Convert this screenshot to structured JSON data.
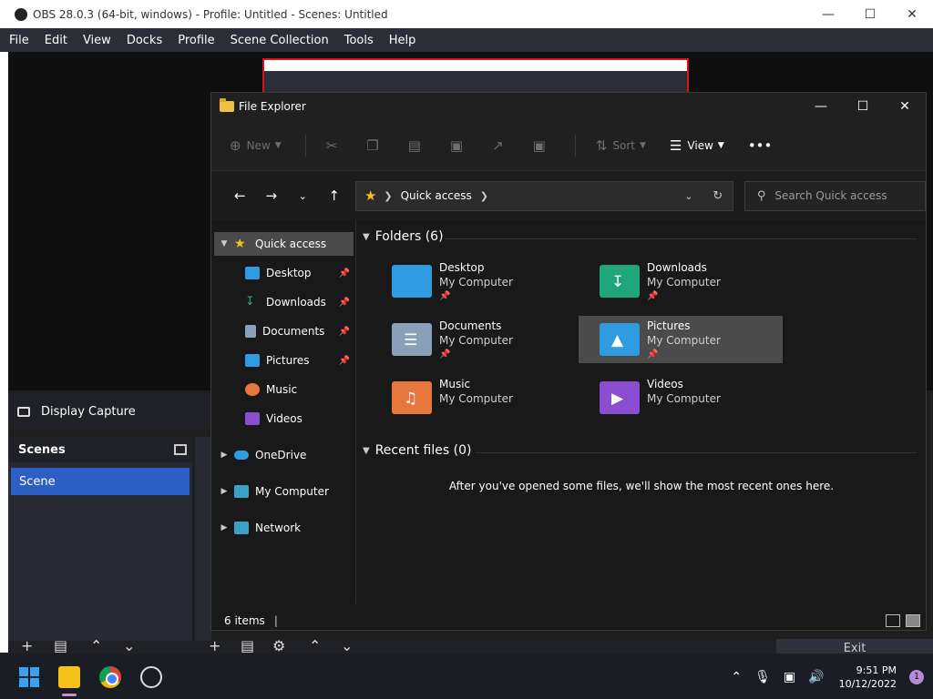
{
  "obs": {
    "title": "OBS 28.0.3 (64-bit, windows) - Profile: Untitled - Scenes: Untitled",
    "menu": [
      "File",
      "Edit",
      "View",
      "Docks",
      "Profile",
      "Scene Collection",
      "Tools",
      "Help"
    ],
    "source_label": "Display Capture",
    "scenes_header": "Scenes",
    "scene_item": "Scene",
    "exit_label": "Exit"
  },
  "explorer": {
    "title": "File Explorer",
    "cmd": {
      "new": "New",
      "sort": "Sort",
      "view": "View"
    },
    "address": {
      "root_crumb": "Quick access"
    },
    "search_placeholder": "Search Quick access",
    "tree": [
      {
        "label": "Quick access",
        "icon": "star-icon",
        "selected": true
      },
      {
        "label": "Desktop",
        "icon": "desktop-icon",
        "pinned": true
      },
      {
        "label": "Downloads",
        "icon": "download-icon",
        "pinned": true
      },
      {
        "label": "Documents",
        "icon": "document-icon",
        "pinned": true
      },
      {
        "label": "Pictures",
        "icon": "pictures-icon",
        "pinned": true
      },
      {
        "label": "Music",
        "icon": "music-icon"
      },
      {
        "label": "Videos",
        "icon": "videos-icon"
      },
      {
        "label": "OneDrive",
        "icon": "cloud-icon"
      },
      {
        "label": "My Computer",
        "icon": "computer-icon"
      },
      {
        "label": "Network",
        "icon": "network-icon"
      }
    ],
    "folders_header": "Folders (6)",
    "folders": [
      {
        "name": "Desktop",
        "location": "My Computer",
        "color": "#2f9be0",
        "pinned": true
      },
      {
        "name": "Downloads",
        "location": "My Computer",
        "color": "#1fa67a",
        "pinned": true
      },
      {
        "name": "Documents",
        "location": "My Computer",
        "color": "#8aa0b8",
        "pinned": true
      },
      {
        "name": "Pictures",
        "location": "My Computer",
        "color": "#2f9be0",
        "pinned": true
      },
      {
        "name": "Music",
        "location": "My Computer",
        "color": "#e8773e",
        "pinned": false
      },
      {
        "name": "Videos",
        "location": "My Computer",
        "color": "#8a4fd0",
        "pinned": false
      }
    ],
    "recent_header": "Recent files (0)",
    "recent_empty": "After you've opened some files, we'll show the most recent ones here.",
    "status_items": "6 items"
  },
  "taskbar": {
    "time": "9:51 PM",
    "date": "10/12/2022",
    "notifications": "1"
  }
}
